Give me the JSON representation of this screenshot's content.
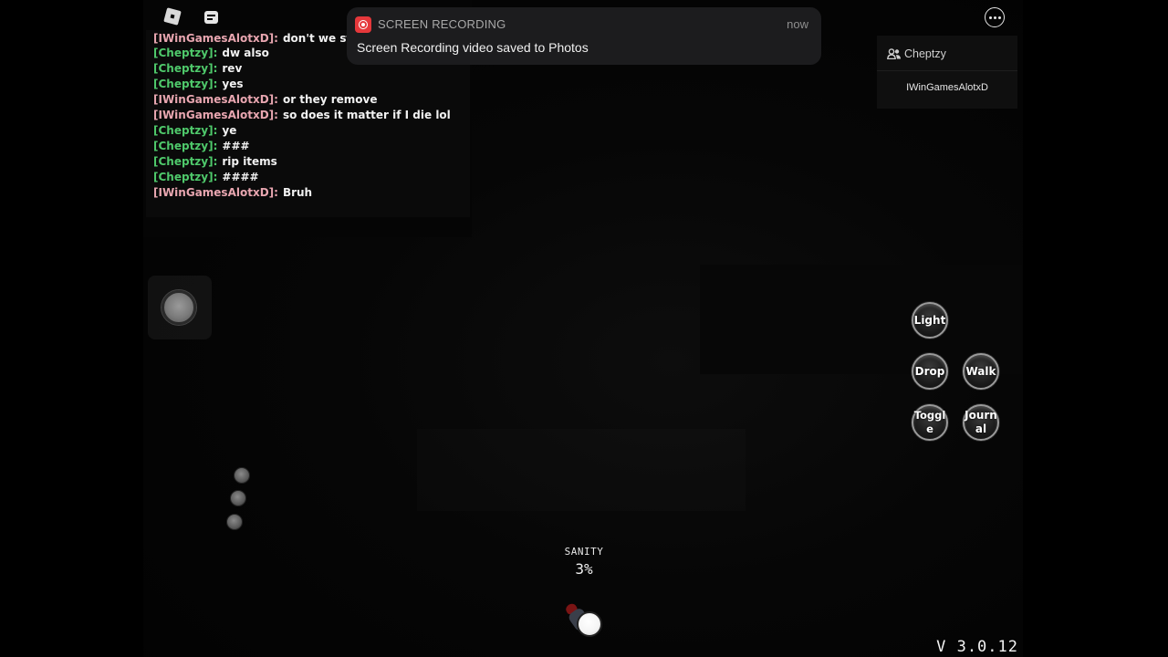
{
  "topbar": {
    "roblox_icon": "roblox-logo-icon",
    "chat_icon": "chat-icon"
  },
  "chat": {
    "messages": [
      {
        "name": "[IWinGamesAlotxD]:",
        "text": "don't we still g",
        "color": "#e8a6b0"
      },
      {
        "name": "[Cheptzy]:",
        "text": "dw also",
        "color": "#4fc96b"
      },
      {
        "name": "[Cheptzy]:",
        "text": "rev",
        "color": "#4fc96b"
      },
      {
        "name": "[Cheptzy]:",
        "text": "yes",
        "color": "#4fc96b"
      },
      {
        "name": "[IWinGamesAlotxD]:",
        "text": "or they remove",
        "color": "#e8a6b0"
      },
      {
        "name": "[IWinGamesAlotxD]:",
        "text": "so does it matter if I die lol",
        "color": "#e8a6b0"
      },
      {
        "name": "[Cheptzy]:",
        "text": "ye",
        "color": "#4fc96b"
      },
      {
        "name": "[Cheptzy]:",
        "text": "###",
        "color": "#4fc96b"
      },
      {
        "name": "[Cheptzy]:",
        "text": "rip items",
        "color": "#4fc96b"
      },
      {
        "name": "[Cheptzy]:",
        "text": "####",
        "color": "#4fc96b"
      },
      {
        "name": "[IWinGamesAlotxD]:",
        "text": "Bruh",
        "color": "#e8a6b0"
      }
    ]
  },
  "notification": {
    "app_name": "SCREEN RECORDING",
    "time": "now",
    "message": "Screen Recording video saved to Photos",
    "accent": "#e5383b"
  },
  "menu": {
    "more_icon": "ellipsis-icon"
  },
  "player_list": {
    "title": "Cheptzy",
    "players": [
      "IWinGamesAlotxD"
    ]
  },
  "actions": {
    "light": "Light",
    "drop": "Drop",
    "walk": "Walk",
    "toggle": "Toggle",
    "journal": "Journ al"
  },
  "hud": {
    "sanity_label": "SANITY",
    "sanity_value": "3%",
    "version": "V 3.0.12"
  }
}
